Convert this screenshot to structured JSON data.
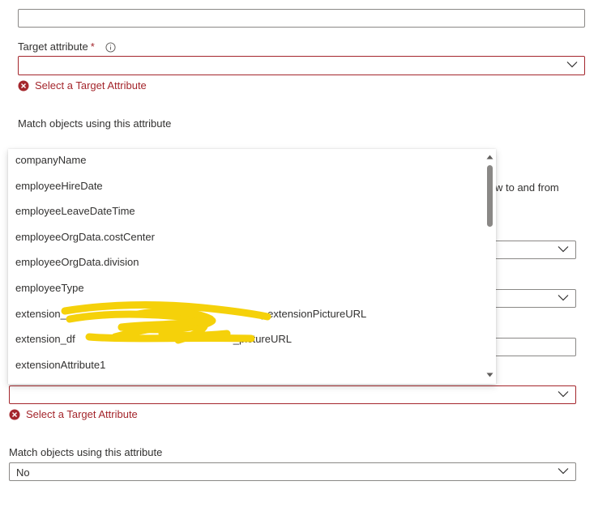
{
  "form": {
    "target_attribute_label": "Target attribute",
    "required_marker": "*",
    "target_attribute_value": "",
    "error_message": "Select a Target Attribute",
    "match_objects_label": "Match objects using this attribute",
    "apply_text_partial": "w to and from",
    "second_target_value": "",
    "second_error_message": "Select a Target Attribute",
    "second_match_label": "Match objects using this attribute",
    "match_value": "No"
  },
  "popup": {
    "options": [
      "companyName",
      "employeeHireDate",
      "employeeLeaveDateTime",
      "employeeOrgData.costCenter",
      "employeeOrgData.division",
      "employeeType",
      "extension_",
      "extension_df",
      "extensionAttribute1"
    ],
    "option_7_suffix": "_extensionPictureURL",
    "option_8_suffix": "_pictureURL"
  },
  "colors": {
    "error": "#a4262c",
    "border": "#8a8886",
    "text": "#323130",
    "redaction": "#f5d10a"
  }
}
